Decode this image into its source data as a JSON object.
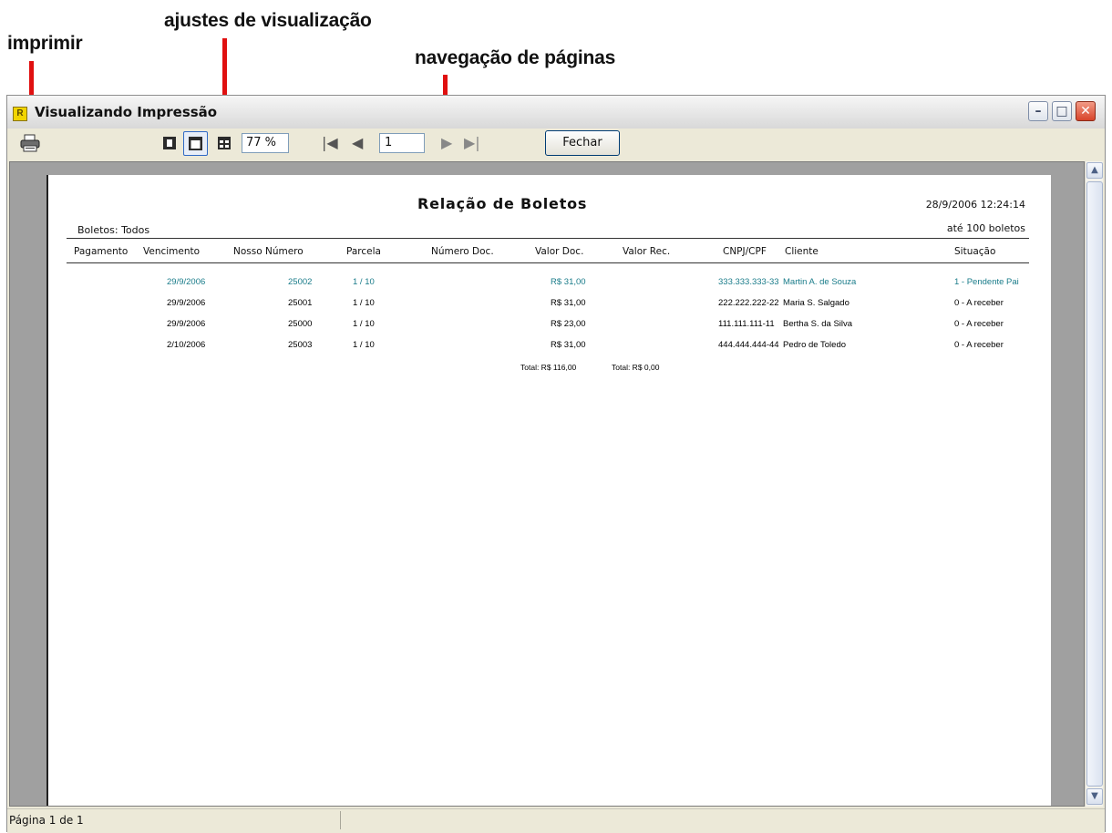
{
  "annotations": {
    "print_label": "imprimir",
    "view_label": "ajustes de visualização",
    "nav_label": "navegação de páginas"
  },
  "window": {
    "title": "Visualizando Impressão",
    "app_icon_letter": "R",
    "controls": {
      "min": "–",
      "max": "□",
      "close": "✕"
    }
  },
  "toolbar": {
    "icons": [
      "printer-icon",
      "single-page-view-icon",
      "page-width-view-icon",
      "multi-page-view-icon"
    ],
    "zoom": "77 %",
    "nav": {
      "first": "|◀",
      "prev": "◀",
      "next": "▶",
      "last": "▶|"
    },
    "page": "1",
    "close_label": "Fechar"
  },
  "report": {
    "title": "Relação de Boletos",
    "datetime": "28/9/2006 12:24:14",
    "filter": "Boletos: Todos",
    "limit": "até 100 boletos",
    "columns": [
      "Pagamento",
      "Vencimento",
      "Nosso Número",
      "Parcela",
      "Número Doc.",
      "Valor Doc.",
      "Valor Rec.",
      "CNPJ/CPF",
      "Cliente",
      "Situação"
    ],
    "rows": [
      {
        "pagamento": "",
        "vencimento": "29/9/2006",
        "nosso_numero": "25002",
        "parcela": "1 / 10",
        "numero_doc": "",
        "valor_doc": "R$ 31,00",
        "valor_rec": "",
        "cnpj_cpf": "333.333.333-33",
        "cliente": "Martin A. de Souza",
        "situacao": "1 - Pendente Pai",
        "highlight": true
      },
      {
        "pagamento": "",
        "vencimento": "29/9/2006",
        "nosso_numero": "25001",
        "parcela": "1 / 10",
        "numero_doc": "",
        "valor_doc": "R$ 31,00",
        "valor_rec": "",
        "cnpj_cpf": "222.222.222-22",
        "cliente": "Maria S. Salgado",
        "situacao": "0 - A receber",
        "highlight": false
      },
      {
        "pagamento": "",
        "vencimento": "29/9/2006",
        "nosso_numero": "25000",
        "parcela": "1 / 10",
        "numero_doc": "",
        "valor_doc": "R$ 23,00",
        "valor_rec": "",
        "cnpj_cpf": "111.111.111-11",
        "cliente": "Bertha S. da Silva",
        "situacao": "0 - A receber",
        "highlight": false
      },
      {
        "pagamento": "",
        "vencimento": "2/10/2006",
        "nosso_numero": "25003",
        "parcela": "1 / 10",
        "numero_doc": "",
        "valor_doc": "R$ 31,00",
        "valor_rec": "",
        "cnpj_cpf": "444.444.444-44",
        "cliente": "Pedro de Toledo",
        "situacao": "0 - A receber",
        "highlight": false
      }
    ],
    "total_doc": "Total: R$ 116,00",
    "total_rec": "Total: R$ 0,00"
  },
  "status": {
    "page_info": "Página 1 de 1"
  },
  "colors": {
    "highlight_row": "#1a7c8a",
    "annotation_line": "#e01010"
  }
}
